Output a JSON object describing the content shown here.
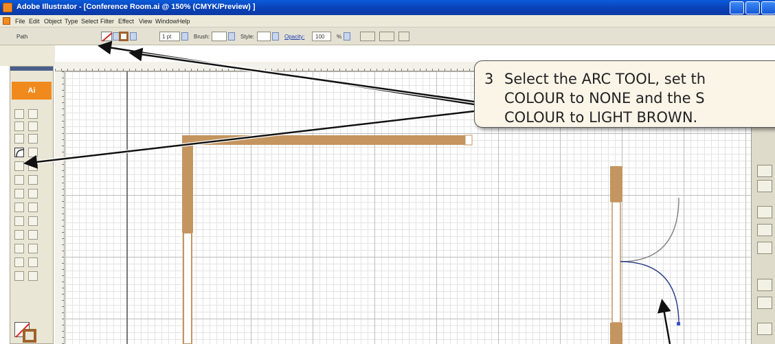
{
  "window": {
    "title": "Adobe Illustrator - [Conference Room.ai @ 150% (CMYK/Preview) ]"
  },
  "menu": {
    "items": [
      "File",
      "Edit",
      "Object",
      "Type",
      "Select",
      "Filter",
      "Effect",
      "View",
      "Window",
      "Help"
    ]
  },
  "control_bar": {
    "selection_label": "Path",
    "stroke_weight": "1 pt",
    "brush_label": "Brush:",
    "style_label": "Style:",
    "opacity_label": "Opacity:",
    "opacity_value": "100",
    "opacity_unit": "%"
  },
  "toolbox": {
    "logo": "Ai"
  },
  "callout": {
    "step_number": "3",
    "line1": "Select the ARC TOOL, set th",
    "line2": "COLOUR to NONE and the S",
    "line3": "COLOUR to LIGHT BROWN."
  },
  "colors": {
    "wall_brown": "#c4955f",
    "stroke_brown": "#a0622a",
    "fill_none_red": "#d22222",
    "ai_orange": "#f18a1d",
    "xp_blue": "#0a4fc6",
    "callout_bg": "#fbf5e8"
  },
  "icons": {
    "fill_swatch": "fill-none-swatch-icon",
    "stroke_swatch": "stroke-brown-swatch-icon",
    "arc_tool": "arc-tool-icon",
    "minimize": "minimize-icon",
    "maximize": "maximize-icon",
    "close": "close-icon"
  }
}
